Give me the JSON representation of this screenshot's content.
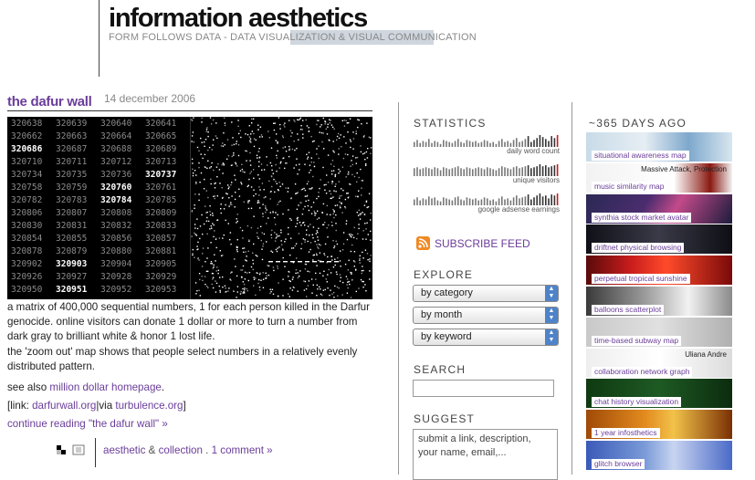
{
  "header": {
    "site_title": "information aesthetics",
    "tagline": "FORM FOLLOWS DATA - DATA VISUALIZATION & VISUAL COMMUNICATION"
  },
  "post": {
    "title": "the dafur wall",
    "date": "14 december 2006",
    "matrix": [
      [
        "320638",
        "320639",
        "320640",
        "320641"
      ],
      [
        "320662",
        "320663",
        "320664",
        "320665"
      ],
      [
        "320686",
        "320687",
        "320688",
        "320689"
      ],
      [
        "320710",
        "320711",
        "320712",
        "320713"
      ],
      [
        "320734",
        "320735",
        "320736",
        "320737"
      ],
      [
        "320758",
        "320759",
        "320760",
        "320761"
      ],
      [
        "320782",
        "320783",
        "320784",
        "320785"
      ],
      [
        "320806",
        "320807",
        "320808",
        "320809"
      ],
      [
        "320830",
        "320831",
        "320832",
        "320833"
      ],
      [
        "320854",
        "320855",
        "320856",
        "320857"
      ],
      [
        "320878",
        "320879",
        "320880",
        "320881"
      ],
      [
        "320902",
        "320903",
        "320904",
        "320905"
      ],
      [
        "320926",
        "320927",
        "320928",
        "320929"
      ],
      [
        "320950",
        "320951",
        "320952",
        "320953"
      ]
    ],
    "highlighted": [
      "320686",
      "320737",
      "320760",
      "320784",
      "320903",
      "320951"
    ],
    "p1": "a matrix of 400,000 sequential numbers, 1 for each person killed in the Darfur genocide. online visitors can donate 1 dollar or more to turn a number from dark gray to brilliant white & honor 1 lost life.",
    "p2": "the 'zoom out' map shows that people select numbers in a relatively evenly distributed pattern.",
    "p3_prefix": "see also ",
    "p3_link": "million dollar homepage",
    "p3_suffix": ".",
    "p4_prefix": "[link: ",
    "p4_link1": "darfurwall.org",
    "p4_sep": "|via ",
    "p4_link2": "turbulence.org",
    "p4_suffix": "]",
    "continue": "continue reading \"the dafur wall\" »",
    "footer": {
      "cat1": "aesthetic",
      "amp": " & ",
      "cat2": "collection",
      "sep": " . ",
      "comments": "1 comment »"
    }
  },
  "statistics": {
    "heading": "STATISTICS",
    "charts": [
      {
        "label": "daily word count",
        "bars": [
          5,
          7,
          4,
          6,
          5,
          8,
          4,
          6,
          5,
          3,
          7,
          6,
          5,
          4,
          6,
          8,
          5,
          4,
          7,
          6,
          5,
          6,
          4,
          5,
          7,
          6,
          4,
          5,
          3,
          6,
          8,
          5,
          6,
          4,
          7,
          9,
          5,
          6,
          8,
          11,
          5,
          7,
          9,
          12,
          10,
          8,
          6,
          11,
          9,
          12
        ]
      },
      {
        "label": "unique visitors",
        "bars": [
          8,
          9,
          7,
          8,
          9,
          8,
          7,
          9,
          8,
          6,
          9,
          8,
          7,
          8,
          9,
          10,
          8,
          7,
          9,
          8,
          7,
          8,
          9,
          8,
          7,
          9,
          8,
          7,
          6,
          8,
          10,
          9,
          8,
          7,
          9,
          10,
          8,
          9,
          10,
          11,
          8,
          9,
          10,
          12,
          10,
          11,
          9,
          10,
          11,
          12
        ]
      },
      {
        "label": "google adsense earnings",
        "bars": [
          6,
          8,
          5,
          7,
          6,
          9,
          7,
          8,
          5,
          4,
          8,
          7,
          6,
          5,
          8,
          9,
          6,
          5,
          8,
          7,
          6,
          7,
          5,
          6,
          8,
          7,
          5,
          6,
          4,
          7,
          9,
          6,
          7,
          5,
          8,
          10,
          7,
          8,
          9,
          11,
          6,
          8,
          10,
          12,
          9,
          10,
          7,
          11,
          10,
          12
        ]
      }
    ],
    "accent": "#cc1a1a"
  },
  "subscribe": {
    "label": "SUBSCRIBE FEED",
    "icon": "rss-icon"
  },
  "explore": {
    "heading": "EXPLORE",
    "selects": [
      "by category",
      "by month",
      "by keyword"
    ]
  },
  "search": {
    "heading": "SEARCH",
    "value": ""
  },
  "suggest": {
    "heading": "SUGGEST",
    "placeholder": "submit a link, description, your name, email,..."
  },
  "days_ago": {
    "heading": "~365 DAYS AGO",
    "items": [
      {
        "caption": "situational awareness map",
        "bg": "linear-gradient(90deg,#c8dbe8,#e6eef4 40%,#7ea8cc 70%,#d8e6f0)"
      },
      {
        "caption": "music similarity map",
        "bg": "linear-gradient(90deg,#f2f2f2,#ffffff 60%,#8a1a12 85%,#f2f2f2)",
        "overlay": "Massive Attack, Protection"
      },
      {
        "caption": "synthia stock market avatar",
        "bg": "linear-gradient(120deg,#2a2a55,#4b2c6e 40%,#c24a8a 60%,#1c1c3c)"
      },
      {
        "caption": "driftnet physical browsing",
        "bg": "linear-gradient(90deg,#101018,#3a3a48 50%,#0e0e14)"
      },
      {
        "caption": "perpetual tropical sunshine",
        "bg": "linear-gradient(90deg,#5a0a0a,#c71c1c 30%,#ff4a2a 55%,#7a0a0a)"
      },
      {
        "caption": "balloons scatterplot",
        "bg": "linear-gradient(90deg,#3a3a3a,#9a9a9a 40%,#f2f2f2 70%,#8a8a8a)"
      },
      {
        "caption": "time-based subway map",
        "bg": "linear-gradient(90deg,#c9c9c9,#e0e0e0 50%,#b0b0b0)"
      },
      {
        "caption": "collaboration network graph",
        "bg": "linear-gradient(90deg,#eeeeee,#ffffff 50%,#dcdcdc)",
        "overlay": "Uliana Andre"
      },
      {
        "caption": "chat history visualization",
        "bg": "linear-gradient(90deg,#0f3a12,#1e5a24 50%,#0c2c0e)"
      },
      {
        "caption": "1 year infosthetics",
        "bg": "linear-gradient(90deg,#a04a08,#e28a1e 40%,#f2c24a 60%,#7a3004)"
      },
      {
        "caption": "glitch browser",
        "bg": "linear-gradient(90deg,#3a5ab8,#7a9ad8 40%,#c8d4f0 60%,#4a6ac8)"
      }
    ]
  }
}
